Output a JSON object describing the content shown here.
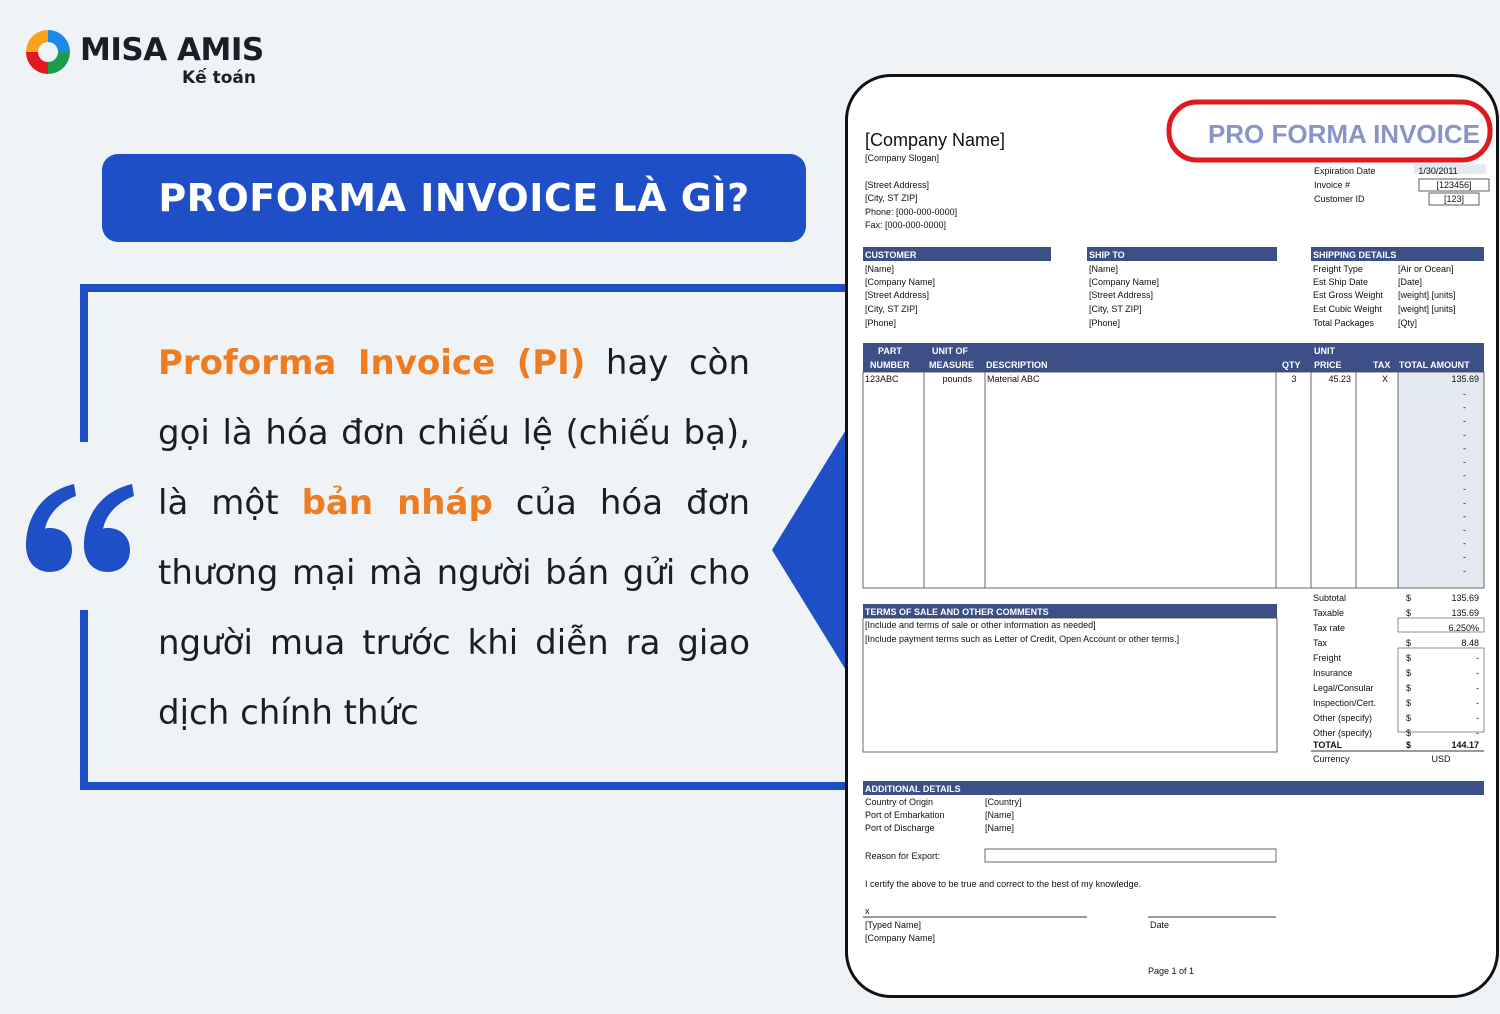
{
  "brand": {
    "name": "MISA AMIS",
    "subtitle": "Kế toán",
    "colors": {
      "primary": "#1e4fc7",
      "accent": "#ee7d22",
      "ring": "#e0191f"
    }
  },
  "banner": {
    "title": "PROFORMA INVOICE LÀ GÌ?"
  },
  "definition": {
    "term": "Proforma Invoice (PI)",
    "part1": " hay còn gọi là hóa đơn chiếu lệ (chiếu bạ), là một ",
    "highlight": "bản nháp",
    "part2": " của hóa đơn thương mại mà người bán gửi cho người mua trước khi diễn ra giao dịch chính thức"
  },
  "invoice": {
    "company_name": "[Company Name]",
    "company_slogan": "[Company Slogan]",
    "title": "PRO FORMA INVOICE",
    "address_lines": [
      "[Street Address]",
      "[City, ST ZIP]",
      "Phone: [000-000-0000]",
      "Fax: [000-000-0000]"
    ],
    "meta_rows": [
      {
        "label": "Expiration Date",
        "value": "1/30/2011"
      },
      {
        "label": "Invoice #",
        "value": "[123456]"
      },
      {
        "label": "Customer ID",
        "value": "[123]"
      }
    ],
    "customer": {
      "heading": "CUSTOMER",
      "lines": [
        "[Name]",
        "[Company Name]",
        "[Street Address]",
        "[City, ST ZIP]",
        "[Phone]"
      ]
    },
    "ship_to": {
      "heading": "SHIP TO",
      "lines": [
        "[Name]",
        "[Company Name]",
        "[Street Address]",
        "[City, ST ZIP]",
        "[Phone]"
      ]
    },
    "shipping": {
      "heading": "SHIPPING DETAILS",
      "rows": [
        {
          "label": "Freight Type",
          "value": "[Air or Ocean]"
        },
        {
          "label": "Est Ship Date",
          "value": "[Date]"
        },
        {
          "label": "Est Gross Weight",
          "value": "[weight] [units]"
        },
        {
          "label": "Est Cubic Weight",
          "value": "[weight] [units]"
        },
        {
          "label": "Total Packages",
          "value": "[Qty]"
        }
      ]
    },
    "columns": {
      "part_1": "PART",
      "part_2": "NUMBER",
      "uom_1": "UNIT OF",
      "uom_2": "MEASURE",
      "desc": "DESCRIPTION",
      "qty": "QTY",
      "price_1": "UNIT",
      "price_2": "PRICE",
      "tax": "TAX",
      "total": "TOTAL AMOUNT"
    },
    "item": {
      "part": "123ABC",
      "uom": "pounds",
      "desc": "Material ABC",
      "qty": "3",
      "price": "45.23",
      "tax": "X",
      "total": "135.69"
    },
    "dash": "-",
    "terms": {
      "heading": "TERMS OF SALE AND OTHER COMMENTS",
      "line1": "[Include and terms of sale or other information as needed]",
      "line2": "[Include payment terms such as Letter of Credit, Open Account or other terms.]"
    },
    "totals": [
      {
        "label": "Subtotal",
        "cur": "$",
        "value": "135.69"
      },
      {
        "label": "Taxable",
        "cur": "$",
        "value": "135.69"
      },
      {
        "label": "Tax rate",
        "cur": "",
        "value": "6.250%"
      },
      {
        "label": "Tax",
        "cur": "$",
        "value": "8.48"
      },
      {
        "label": "Freight",
        "cur": "$",
        "value": "-"
      },
      {
        "label": "Insurance",
        "cur": "$",
        "value": "-"
      },
      {
        "label": "Legal/Consular",
        "cur": "$",
        "value": "-"
      },
      {
        "label": "Inspection/Cert.",
        "cur": "$",
        "value": "-"
      },
      {
        "label": "Other (specify)",
        "cur": "$",
        "value": "-"
      },
      {
        "label": "Other (specify)",
        "cur": "$",
        "value": "-"
      }
    ],
    "grand_total": {
      "label": "TOTAL",
      "cur": "$",
      "value": "144.17"
    },
    "currency": {
      "label": "Currency",
      "value": "USD"
    },
    "additional": {
      "heading": "ADDITIONAL DETAILS",
      "rows": [
        {
          "label": "Country of Origin",
          "value": "[Country]"
        },
        {
          "label": "Port of Embarkation",
          "value": "[Name]"
        },
        {
          "label": "Port of Discharge",
          "value": "[Name]"
        }
      ],
      "reason_label": "Reason for Export:"
    },
    "certify": "I certify the above to be true and correct to the best of my knowledge.",
    "sign_x": "x",
    "typed_name": "[Typed Name]",
    "signer_company": "[Company Name]",
    "date_label": "Date",
    "page": "Page 1 of 1"
  }
}
